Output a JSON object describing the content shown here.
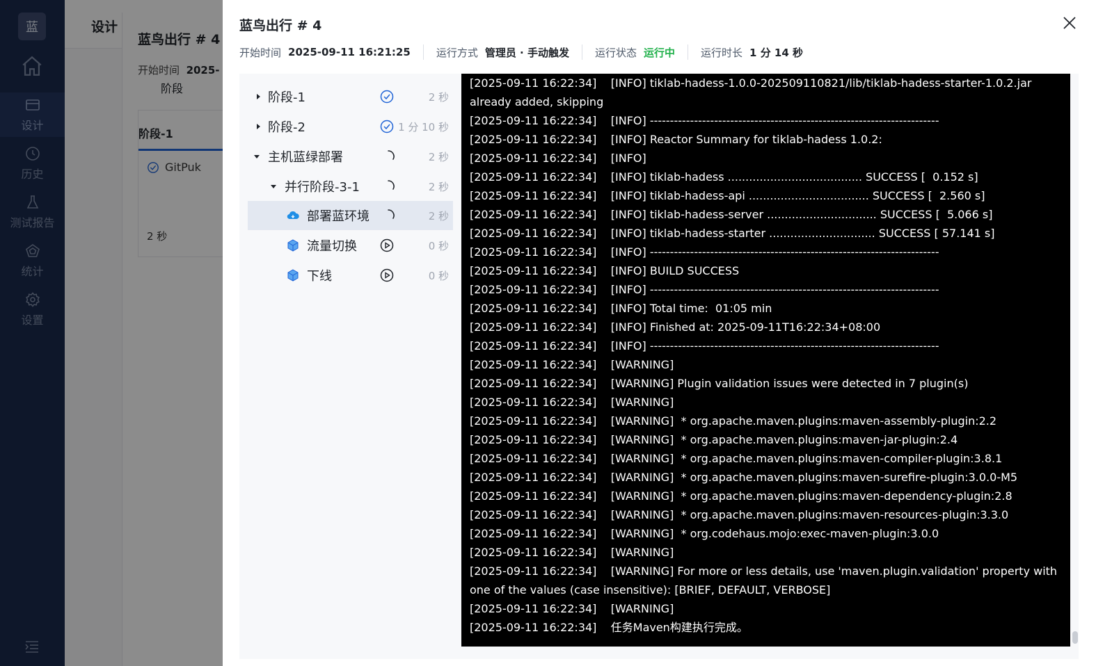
{
  "nav": {
    "logo": "蓝",
    "items": [
      {
        "label": "设计",
        "icon": "design-icon"
      },
      {
        "label": "历史",
        "icon": "history-icon"
      },
      {
        "label": "测试报告",
        "icon": "test-report-icon"
      },
      {
        "label": "统计",
        "icon": "statistics-icon"
      },
      {
        "label": "设置",
        "icon": "settings-icon"
      }
    ]
  },
  "background": {
    "header_title": "设计",
    "pipeline_title": "蓝鸟出行 # 4",
    "start_label": "开始时间",
    "start_value": "2025-",
    "tab": "阶段",
    "stage_title": "阶段-1",
    "task": "GitPuk",
    "duration": "2 秒"
  },
  "drawer": {
    "title": "蓝鸟出行 # 4",
    "meta": {
      "start_label": "开始时间",
      "start_value": "2025-09-11 16:21:25",
      "mode_label": "运行方式",
      "mode_value": "管理员 · 手动触发",
      "status_label": "运行状态",
      "status_value": "运行中",
      "duration_label": "运行时长",
      "duration_value": "1 分 14 秒"
    },
    "tree": [
      {
        "label": "阶段-1",
        "duration": "2 秒",
        "status": "success"
      },
      {
        "label": "阶段-2",
        "duration": "1 分 10 秒",
        "status": "success"
      },
      {
        "label": "主机蓝绿部署",
        "duration": "2 秒",
        "status": "running"
      },
      {
        "label": "并行阶段-3-1",
        "duration": "2 秒",
        "status": "running"
      },
      {
        "label": "部署蓝环境",
        "duration": "2 秒",
        "status": "running"
      },
      {
        "label": "流量切换",
        "duration": "0 秒",
        "status": "pending"
      },
      {
        "label": "下线",
        "duration": "0 秒",
        "status": "pending"
      }
    ],
    "log": [
      "[2025-09-11 16:22:34]    [INFO] tiklab-hadess-1.0.0-202509110821/lib/tiklab-hadess-starter-1.0.2.jar already added, skipping",
      "[2025-09-11 16:22:34]    [INFO] ------------------------------------------------------------------------",
      "[2025-09-11 16:22:34]    [INFO] Reactor Summary for tiklab-hadess 1.0.2:",
      "[2025-09-11 16:22:34]    [INFO]",
      "[2025-09-11 16:22:34]    [INFO] tiklab-hadess ...................................... SUCCESS [  0.152 s]",
      "[2025-09-11 16:22:34]    [INFO] tiklab-hadess-api .................................. SUCCESS [  2.560 s]",
      "[2025-09-11 16:22:34]    [INFO] tiklab-hadess-server ............................... SUCCESS [  5.066 s]",
      "[2025-09-11 16:22:34]    [INFO] tiklab-hadess-starter .............................. SUCCESS [ 57.141 s]",
      "[2025-09-11 16:22:34]    [INFO] ------------------------------------------------------------------------",
      "[2025-09-11 16:22:34]    [INFO] BUILD SUCCESS",
      "[2025-09-11 16:22:34]    [INFO] ------------------------------------------------------------------------",
      "[2025-09-11 16:22:34]    [INFO] Total time:  01:05 min",
      "[2025-09-11 16:22:34]    [INFO] Finished at: 2025-09-11T16:22:34+08:00",
      "[2025-09-11 16:22:34]    [INFO] ------------------------------------------------------------------------",
      "[2025-09-11 16:22:34]    [WARNING]",
      "[2025-09-11 16:22:34]    [WARNING] Plugin validation issues were detected in 7 plugin(s)",
      "[2025-09-11 16:22:34]    [WARNING]",
      "[2025-09-11 16:22:34]    [WARNING]  * org.apache.maven.plugins:maven-assembly-plugin:2.2",
      "[2025-09-11 16:22:34]    [WARNING]  * org.apache.maven.plugins:maven-jar-plugin:2.4",
      "[2025-09-11 16:22:34]    [WARNING]  * org.apache.maven.plugins:maven-compiler-plugin:3.8.1",
      "[2025-09-11 16:22:34]    [WARNING]  * org.apache.maven.plugins:maven-surefire-plugin:3.0.0-M5",
      "[2025-09-11 16:22:34]    [WARNING]  * org.apache.maven.plugins:maven-dependency-plugin:2.8",
      "[2025-09-11 16:22:34]    [WARNING]  * org.apache.maven.plugins:maven-resources-plugin:3.3.0",
      "[2025-09-11 16:22:34]    [WARNING]  * org.codehaus.mojo:exec-maven-plugin:3.0.0",
      "[2025-09-11 16:22:34]    [WARNING]",
      "[2025-09-11 16:22:34]    [WARNING] For more or less details, use 'maven.plugin.validation' property with one of the values (case insensitive): [BRIEF, DEFAULT, VERBOSE]",
      "[2025-09-11 16:22:34]    [WARNING]",
      "[2025-09-11 16:22:34]    任务Maven构建执行完成。"
    ]
  },
  "colors": {
    "nav_bg": "#1b2a4e",
    "running": "#22b14c",
    "success": "#1f63d6",
    "log_bg": "#000000"
  }
}
